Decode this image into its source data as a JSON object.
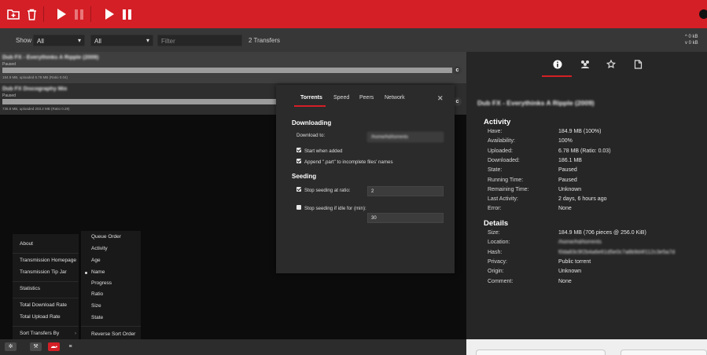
{
  "colors": {
    "accent": "#d41f26",
    "toolbar": "#d41f26",
    "panel": "#262626",
    "list_bg": "#0c0c0c"
  },
  "toolbar": {
    "icons": [
      "open-torrent-icon",
      "remove-icon",
      "start-icon",
      "pause-icon",
      "start-all-icon",
      "pause-all-icon"
    ]
  },
  "filterbar": {
    "show_label": "Show",
    "state_select": "All",
    "tracker_select": "All",
    "filter_placeholder": "Filter",
    "transfers_count": "2 Transfers",
    "download_rate": "^ 0 kB",
    "upload_rate": "v 0 kB"
  },
  "torrents": [
    {
      "name": "Dub FX - Everythinks A Ripple (2009)",
      "status": "Paused",
      "progress": 1.0,
      "peers": "184.9 MB, uploaded 6.78 MB (Ratio 0.04)"
    },
    {
      "name": "Dub FX Discography Mix",
      "status": "Paused",
      "progress": 1.0,
      "peers": "736.8 MB, uploaded 203.2 MB (Ratio 0.28)"
    }
  ],
  "inspector": {
    "tabs": [
      "info-icon",
      "peers-icon",
      "trackers-icon",
      "files-icon"
    ],
    "name": "Dub FX - Everythinks A Ripple (2009)",
    "activity_title": "Activity",
    "activity": [
      {
        "k": "Have:",
        "v": "184.9 MB (100%)"
      },
      {
        "k": "Availability:",
        "v": "100%"
      },
      {
        "k": "Uploaded:",
        "v": "6.78 MB (Ratio: 0.03)"
      },
      {
        "k": "Downloaded:",
        "v": "186.1 MB"
      },
      {
        "k": "State:",
        "v": "Paused"
      },
      {
        "k": "Running Time:",
        "v": "Paused"
      },
      {
        "k": "Remaining Time:",
        "v": "Unknown"
      },
      {
        "k": "Last Activity:",
        "v": "2 days, 6 hours ago"
      },
      {
        "k": "Error:",
        "v": "None"
      }
    ],
    "details_title": "Details",
    "details": [
      {
        "k": "Size:",
        "v": "184.9 MB (706 pieces @ 256.0 KiB)"
      },
      {
        "k": "Location:",
        "v": "/home/hd/torrents"
      },
      {
        "k": "Hash:",
        "v": "f0da83c9f2b4a6e61d5e0c7a8b9d4f112c3e5a7d"
      },
      {
        "k": "Privacy:",
        "v": "Public torrent"
      },
      {
        "k": "Origin:",
        "v": "Unknown"
      },
      {
        "k": "Comment:",
        "v": "None"
      }
    ]
  },
  "prefs": {
    "tabs": [
      "Torrents",
      "Speed",
      "Peers",
      "Network"
    ],
    "downloading_title": "Downloading",
    "download_to_label": "Download to:",
    "download_to_value": "/home/hd/torrents",
    "start_when_added": "Start when added",
    "append_part": "Append \".part\" to incomplete files' names",
    "seeding_title": "Seeding",
    "stop_ratio_label": "Stop seeding at ratio:",
    "stop_ratio_value": "2",
    "stop_idle_label": "Stop seeding if idle for (min):",
    "stop_idle_value": "30"
  },
  "menu": {
    "items": [
      "About",
      "Transmission Homepage",
      "Transmission Tip Jar",
      "Statistics",
      "Total Download Rate",
      "Total Upload Rate",
      "Sort Transfers By"
    ],
    "sort_items": [
      "Queue Order",
      "Activity",
      "Age",
      "Name",
      "Progress",
      "Ratio",
      "Size",
      "State",
      "Reverse Sort Order"
    ]
  },
  "footer": {
    "icons": [
      "settings-icon",
      "wrench-icon",
      "turtle-icon",
      "compact-view-icon"
    ]
  }
}
